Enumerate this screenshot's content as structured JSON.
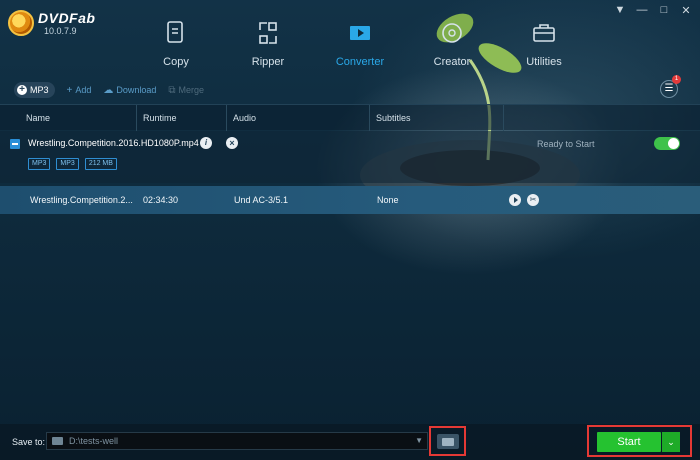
{
  "app": {
    "name": "DVDFab",
    "version": "10.0.7.9"
  },
  "window_controls": {
    "settings": "▼",
    "minimize": "—",
    "maximize": "□",
    "close": "✕"
  },
  "modules": [
    {
      "label": "Copy",
      "icon": "copy-icon"
    },
    {
      "label": "Ripper",
      "icon": "ripper-icon"
    },
    {
      "label": "Converter",
      "icon": "converter-icon",
      "active": true
    },
    {
      "label": "Creator",
      "icon": "creator-icon"
    },
    {
      "label": "Utilities",
      "icon": "utilities-icon"
    }
  ],
  "toolbar": {
    "profile": "MP3",
    "add": "Add",
    "download": "Download",
    "merge": "Merge"
  },
  "queue": {
    "badge": "1"
  },
  "table": {
    "columns": [
      "Name",
      "Runtime",
      "Audio",
      "Subtitles"
    ]
  },
  "file": {
    "name": "Wrestling.Competition.2016.HD1080P.mp4",
    "tags": [
      "MP3",
      "MP3",
      "212 MB"
    ],
    "status": "Ready to Start",
    "enabled": true
  },
  "title": {
    "name": "Wrestling.Competition.2...",
    "runtime": "02:34:30",
    "audio": "Und AC-3/5.1",
    "subtitles": "None"
  },
  "bottom": {
    "save_label": "Save to:",
    "path": "D:\\tests-well",
    "start": "Start",
    "dropdown": "⌄"
  },
  "colors": {
    "accent": "#2aa8e8",
    "start": "#25c230",
    "highlight_box": "#e53935"
  }
}
